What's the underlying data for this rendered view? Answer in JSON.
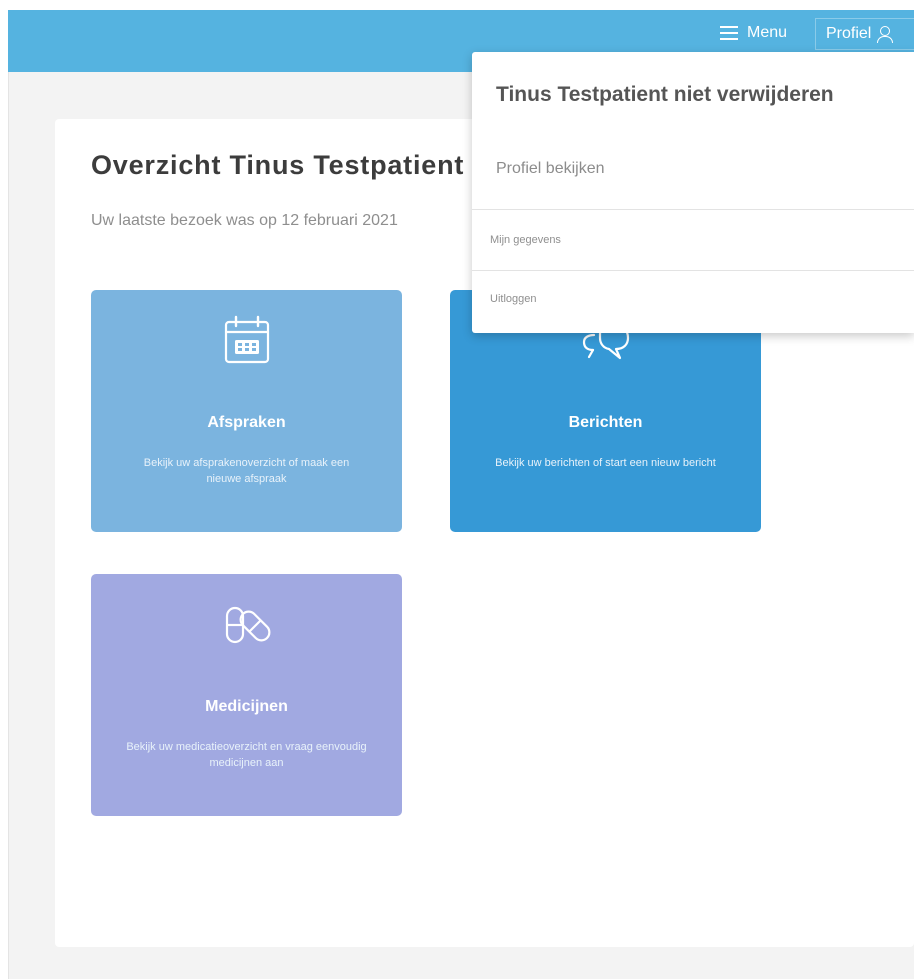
{
  "header": {
    "menu_label": "Menu",
    "profile_label": "Profiel",
    "accent_color": "#55b3e0"
  },
  "main": {
    "title": "Overzicht Tinus Testpatient niet verwijderen",
    "last_visit": "Uw laatste bezoek was op 12 februari 2021"
  },
  "tiles": [
    {
      "title": "Afspraken",
      "description": "Bekijk uw afsprakenoverzicht of maak een nieuwe afspraak",
      "icon": "calendar-icon",
      "color": "#7bb4df"
    },
    {
      "title": "Berichten",
      "description": "Bekijk uw berichten of start een nieuw bericht",
      "icon": "chat-bubbles-icon",
      "color": "#3699d6"
    },
    {
      "title": "Medicijnen",
      "description": "Bekijk uw medicatieoverzicht en vraag eenvoudig medicijnen aan",
      "icon": "pills-icon",
      "color": "#a1a9e1"
    }
  ],
  "profile_menu": {
    "user_name": "Tinus Testpatient niet verwijderen",
    "view_profile": "Profiel bekijken",
    "items": [
      "Mijn gegevens",
      "Uitloggen"
    ]
  }
}
